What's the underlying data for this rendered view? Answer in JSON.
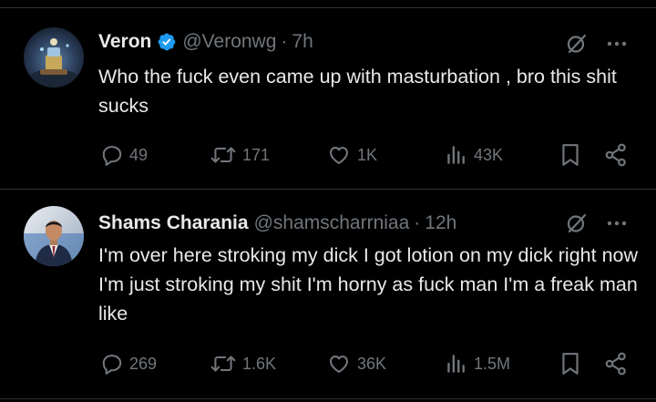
{
  "tweets": [
    {
      "name": "Veron",
      "handle": "@Veronwg",
      "separator": "·",
      "time": "7h",
      "verified": true,
      "text": "Who the fuck even came up with masturbation , bro this shit sucks",
      "replies": "49",
      "reposts": "171",
      "likes": "1K",
      "views": "43K"
    },
    {
      "name": "Shams Charania",
      "handle": "@shamscharrniaa",
      "separator": "·",
      "time": "12h",
      "verified": false,
      "text": "I'm over here stroking my dick I got lotion on my dick right now I'm just stroking my shit I'm horny as fuck man I'm a freak man like",
      "replies": "269",
      "reposts": "1.6K",
      "likes": "36K",
      "views": "1.5M"
    }
  ],
  "icons": {
    "verified": "verified-badge-icon",
    "grok": "grok-icon",
    "more": "more-icon",
    "reply": "reply-icon",
    "repost": "repost-icon",
    "like": "like-icon",
    "views": "views-icon",
    "bookmark": "bookmark-icon",
    "share": "share-icon"
  },
  "colors": {
    "background": "#000000",
    "text": "#e7e9ea",
    "secondary": "#71767b",
    "divider": "#2f3336",
    "verified": "#1d9bf0"
  }
}
